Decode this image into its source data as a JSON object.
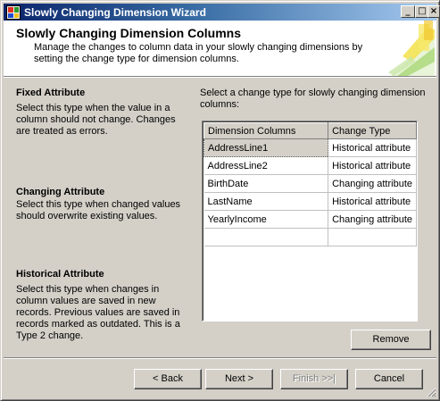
{
  "window": {
    "title": "Slowly Changing Dimension Wizard",
    "controls": {
      "minimize": "_",
      "maximize": "□",
      "close": "×"
    }
  },
  "header": {
    "title": "Slowly Changing Dimension Columns",
    "description": "Manage the changes to column data in your slowly changing dimensions by setting the change type for dimension columns."
  },
  "sections": [
    {
      "heading": "Fixed Attribute",
      "description": "Select this type when the value in a column should not change. Changes are treated as errors."
    },
    {
      "heading": "Changing Attribute",
      "description": "Select this type when changed values should overwrite existing values."
    },
    {
      "heading": "Historical Attribute",
      "description": "Select this type when changes in column values are saved in new records. Previous values are saved in records marked as outdated. This is a Type 2 change."
    }
  ],
  "grid": {
    "prompt": "Select a change type for slowly changing dimension columns:",
    "columns": [
      "Dimension Columns",
      "Change Type"
    ],
    "rows": [
      {
        "column": "AddressLine1",
        "change_type": "Historical attribute"
      },
      {
        "column": "AddressLine2",
        "change_type": "Historical attribute"
      },
      {
        "column": "BirthDate",
        "change_type": "Changing attribute"
      },
      {
        "column": "LastName",
        "change_type": "Historical attribute"
      },
      {
        "column": "YearlyIncome",
        "change_type": "Changing attribute"
      },
      {
        "column": "",
        "change_type": ""
      }
    ],
    "selected_row": 0
  },
  "buttons": {
    "remove": "Remove",
    "back": "< Back",
    "next": "Next >",
    "finish": "Finish >>|",
    "cancel": "Cancel"
  }
}
